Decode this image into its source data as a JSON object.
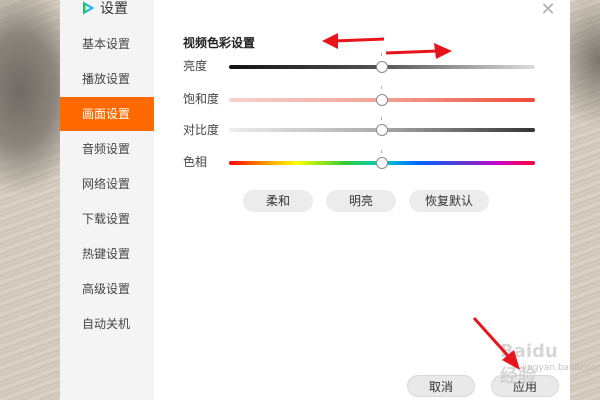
{
  "app": {
    "title": "设置"
  },
  "sidebar": {
    "items": [
      {
        "label": "基本设置"
      },
      {
        "label": "播放设置"
      },
      {
        "label": "画面设置"
      },
      {
        "label": "音频设置"
      },
      {
        "label": "网络设置"
      },
      {
        "label": "下载设置"
      },
      {
        "label": "热键设置"
      },
      {
        "label": "高级设置"
      },
      {
        "label": "自动关机"
      }
    ],
    "active_index": 2
  },
  "panel": {
    "section_title": "视频色彩设置",
    "sliders": [
      {
        "label": "亮度",
        "value": 0.5
      },
      {
        "label": "饱和度",
        "value": 0.5
      },
      {
        "label": "对比度",
        "value": 0.5
      },
      {
        "label": "色相",
        "value": 0.5
      }
    ],
    "presets": [
      {
        "label": "柔和"
      },
      {
        "label": "明亮"
      },
      {
        "label": "恢复默认"
      }
    ]
  },
  "footer": {
    "cancel_label": "取消",
    "apply_label": "应用"
  },
  "watermark": {
    "text": "Baidu经验",
    "sub": "jingyan.baidu.com"
  },
  "colors": {
    "accent": "#ff6a00",
    "annotation_arrow": "#e8141b"
  },
  "icons": {
    "app_logo": "tencent-video-logo-icon",
    "close": "close-icon"
  }
}
